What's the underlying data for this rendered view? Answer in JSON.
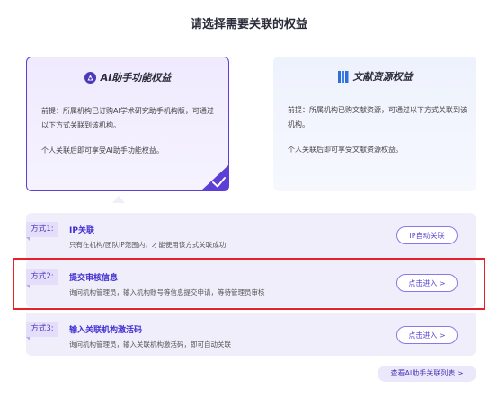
{
  "page_title": "请选择需要关联的权益",
  "cards": {
    "ai": {
      "icon": "ai-assistant-icon",
      "title": "AI助手功能权益",
      "premise": "前提：所属机构已订购AI学术研究助手机构版，可通过以下方式关联到该机构。",
      "benefit": "个人关联后即可享受AI助手功能权益。",
      "selected": true
    },
    "lit": {
      "icon": "book-icon",
      "title": "文献资源权益",
      "premise": "前提：所属机构已购文献资源，可通过以下方式关联到该机构。",
      "benefit": "个人关联后即可享受文献资源权益。",
      "selected": false
    }
  },
  "modes": [
    {
      "tag": "方式1:",
      "title": "IP关联",
      "desc": "只有在机构/团队IP范围内，才能使用该方式关联成功",
      "action": "IP自动关联"
    },
    {
      "tag": "方式2:",
      "title": "提交审核信息",
      "desc": "询问机构管理员，输入机构账号等信息提交申请，等待管理员审核",
      "action": "点击进入 >"
    },
    {
      "tag": "方式3:",
      "title": "输入关联机构激活码",
      "desc": "询问机构管理员，输入关联机构激活码，即可自动关联",
      "action": "点击进入 >"
    }
  ],
  "footer_link": "查看AI助手关联列表 >",
  "colors": {
    "accent": "#5b3fd6",
    "highlight": "#e6212a",
    "row_bg": "#f1eefb"
  }
}
